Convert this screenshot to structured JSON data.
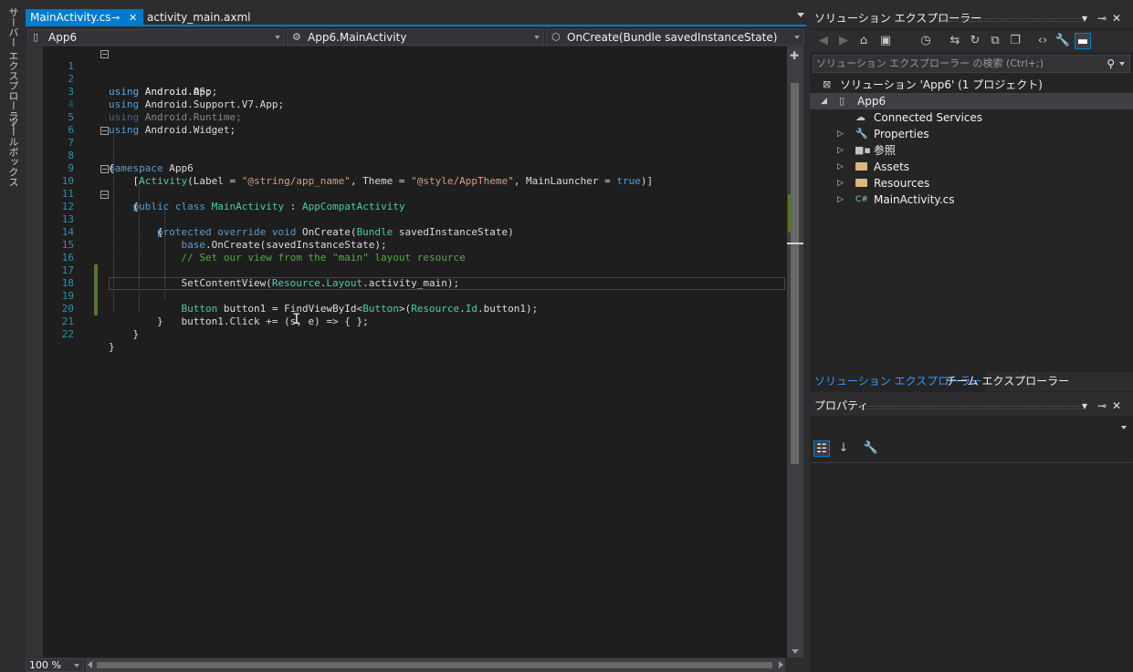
{
  "left_strip": {
    "server_explorer": "サーバー エクスプローラー",
    "toolbox": "ツールボックス"
  },
  "document_tabs": [
    {
      "label": "MainActivity.cs",
      "active": true
    },
    {
      "label": "activity_main.axml",
      "active": false
    }
  ],
  "nav": {
    "project": "App6",
    "class": "App6.MainActivity",
    "member": "OnCreate(Bundle savedInstanceState)"
  },
  "editor": {
    "line_numbers": [
      "1",
      "2",
      "3",
      "4",
      "5",
      "6",
      "7",
      "8",
      "9",
      "10",
      "11",
      "12",
      "13",
      "14",
      "15",
      "16",
      "17",
      "18",
      "19",
      "20",
      "21",
      "22"
    ],
    "lines": [
      "using Android.App;",
      "using Android.OS;",
      "using Android.Support.V7.App;",
      "using Android.Runtime;",
      "using Android.Widget;",
      "",
      "namespace App6",
      "{",
      "    [Activity(Label = \"@string/app_name\", Theme = \"@style/AppTheme\", MainLauncher = true)]",
      "    public class MainActivity : AppCompatActivity",
      "    {",
      "        protected override void OnCreate(Bundle savedInstanceState)",
      "        {",
      "            base.OnCreate(savedInstanceState);",
      "            // Set our view from the \"main\" layout resource",
      "            SetContentView(Resource.Layout.activity_main);",
      "",
      "            Button button1 = FindViewById<Button>(Resource.Id.button1);",
      "            button1.Click += (s, e) => { };",
      "        }",
      "    }",
      "}"
    ],
    "zoom": "100 %"
  },
  "solution_explorer": {
    "title": "ソリューション エクスプローラー",
    "search_placeholder": "ソリューション エクスプローラー の検索 (Ctrl+;)",
    "tree": [
      {
        "label": "ソリューション 'App6' (1 プロジェクト)",
        "icon": "solution-icon"
      },
      {
        "label": "App6",
        "icon": "csharp-project-icon"
      },
      {
        "label": "Connected Services",
        "icon": "cloud-icon"
      },
      {
        "label": "Properties",
        "icon": "wrench-icon"
      },
      {
        "label": "参照",
        "icon": "references-icon"
      },
      {
        "label": "Assets",
        "icon": "folder-icon"
      },
      {
        "label": "Resources",
        "icon": "folder-icon"
      },
      {
        "label": "MainActivity.cs",
        "icon": "csharp-file-icon"
      }
    ]
  },
  "panel_tabs": [
    {
      "label": "ソリューション エクスプローラー",
      "active": true
    },
    {
      "label": "チーム エクスプローラー",
      "active": false
    }
  ],
  "properties": {
    "title": "プロパティ"
  },
  "colors": {
    "accent": "#007acc",
    "keyword": "#569cd6",
    "type": "#4ec9b0",
    "string": "#d69d85",
    "comment": "#57a64a",
    "line_number": "#2b91af",
    "editor_bg": "#1e1e1e"
  }
}
